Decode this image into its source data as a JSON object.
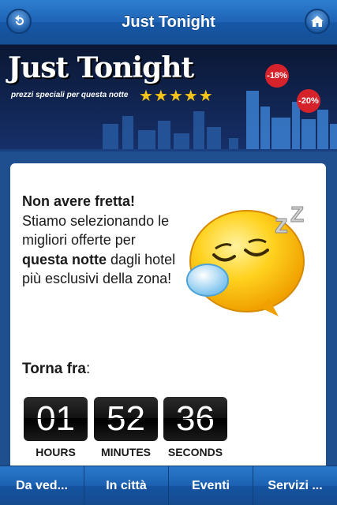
{
  "header": {
    "title": "Just Tonight"
  },
  "banner": {
    "title": "Just Tonight",
    "subtitle": "prezzi speciali per questa notte",
    "stars": "★★★★★",
    "discount_1": "-18%",
    "discount_2": "-20%"
  },
  "message": {
    "heading": "Non avere fretta!",
    "text_1": "Stiamo selezionando le migliori offerte per",
    "bold": "questa notte",
    "text_2": "dagli hotel più esclusivi della zona!"
  },
  "countdown": {
    "label": "Torna fra",
    "colon": ":",
    "hours": {
      "value": "01",
      "label": "HOURS"
    },
    "minutes": {
      "value": "52",
      "label": "MINUTES"
    },
    "seconds": {
      "value": "36",
      "label": "SECONDS"
    }
  },
  "tabs": [
    {
      "label": "Da ved..."
    },
    {
      "label": "In città"
    },
    {
      "label": "Eventi"
    },
    {
      "label": "Servizi ..."
    }
  ],
  "colors": {
    "accent": "#1e63b5",
    "discount": "#d6222b",
    "stars": "#f5c518"
  }
}
